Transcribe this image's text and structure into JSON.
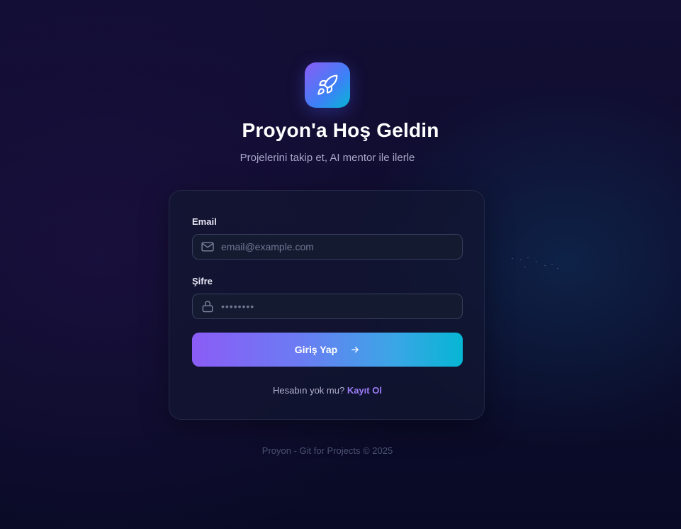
{
  "header": {
    "logo_icon": "rocket-icon",
    "title": "Proyon'a Hoş Geldin",
    "subtitle": "Projelerini takip et, AI mentor ile ilerle"
  },
  "form": {
    "email_label": "Email",
    "email_placeholder": "email@example.com",
    "email_icon": "mail-icon",
    "password_label": "Şifre",
    "password_placeholder": "••••••••",
    "password_icon": "lock-icon",
    "submit_label": "Giriş Yap",
    "submit_icon": "arrow-right-icon",
    "signup_prompt": "Hesabın yok mu?",
    "signup_link": "Kayıt Ol"
  },
  "footer": {
    "text": "Proyon - Git for Projects © 2025"
  },
  "colors": {
    "accent_purple": "#8b5cf6",
    "accent_cyan": "#06b6d4",
    "background": "#0d0b2a",
    "link": "#9b7cf7"
  }
}
